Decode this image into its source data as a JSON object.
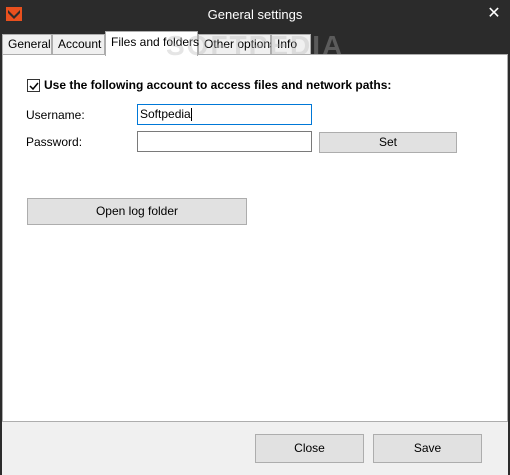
{
  "window": {
    "title": "General settings",
    "close_glyph": "✕"
  },
  "tabs": [
    {
      "label": "General",
      "active": false
    },
    {
      "label": "Account",
      "active": false
    },
    {
      "label": "Files and folders",
      "active": true
    },
    {
      "label": "Other options",
      "active": false
    },
    {
      "label": "Info",
      "active": false
    }
  ],
  "files_and_folders": {
    "use_account_checkbox": {
      "label": "Use the following account to access files and network paths:",
      "checked": true
    },
    "username": {
      "label": "Username:",
      "value": "Softpedia"
    },
    "password": {
      "label": "Password:",
      "value": ""
    },
    "set_button_label": "Set",
    "open_log_folder_label": "Open log folder"
  },
  "footer": {
    "close_label": "Close",
    "save_label": "Save"
  },
  "watermark": "SOFTPEDIA",
  "colors": {
    "titlebar": "#2b2b2b",
    "panel": "#ffffff",
    "footer": "#f0f0f0",
    "button": "#e1e1e1",
    "focus_border": "#0078d7",
    "app_icon": "#e8501e"
  }
}
